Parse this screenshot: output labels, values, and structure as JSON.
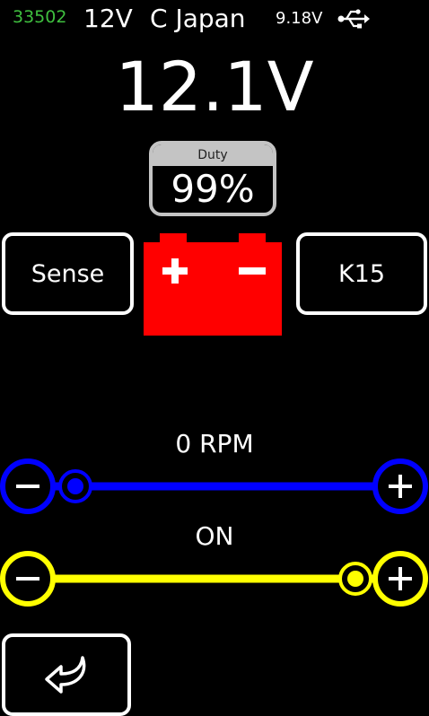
{
  "status_bar": {
    "counter": "33502",
    "system_voltage": "12V",
    "region": "C Japan",
    "usb_voltage": "9.18V",
    "usb_icon": "usb-icon"
  },
  "main": {
    "voltage": "12.1V",
    "duty": {
      "label": "Duty",
      "value": "99%"
    }
  },
  "buttons": {
    "sense": "Sense",
    "k15": "K15",
    "back_icon": "back-arrow-icon"
  },
  "battery": {
    "icon": "battery-icon",
    "color": "#ff0000"
  },
  "rpm_slider": {
    "label": "0 RPM",
    "color": "#0000ff",
    "level": 0,
    "minus_icon": "minus-icon",
    "plus_icon": "plus-icon"
  },
  "on_slider": {
    "label": "ON",
    "color": "#ffff00",
    "level": 1,
    "minus_icon": "minus-icon",
    "plus_icon": "plus-icon"
  }
}
